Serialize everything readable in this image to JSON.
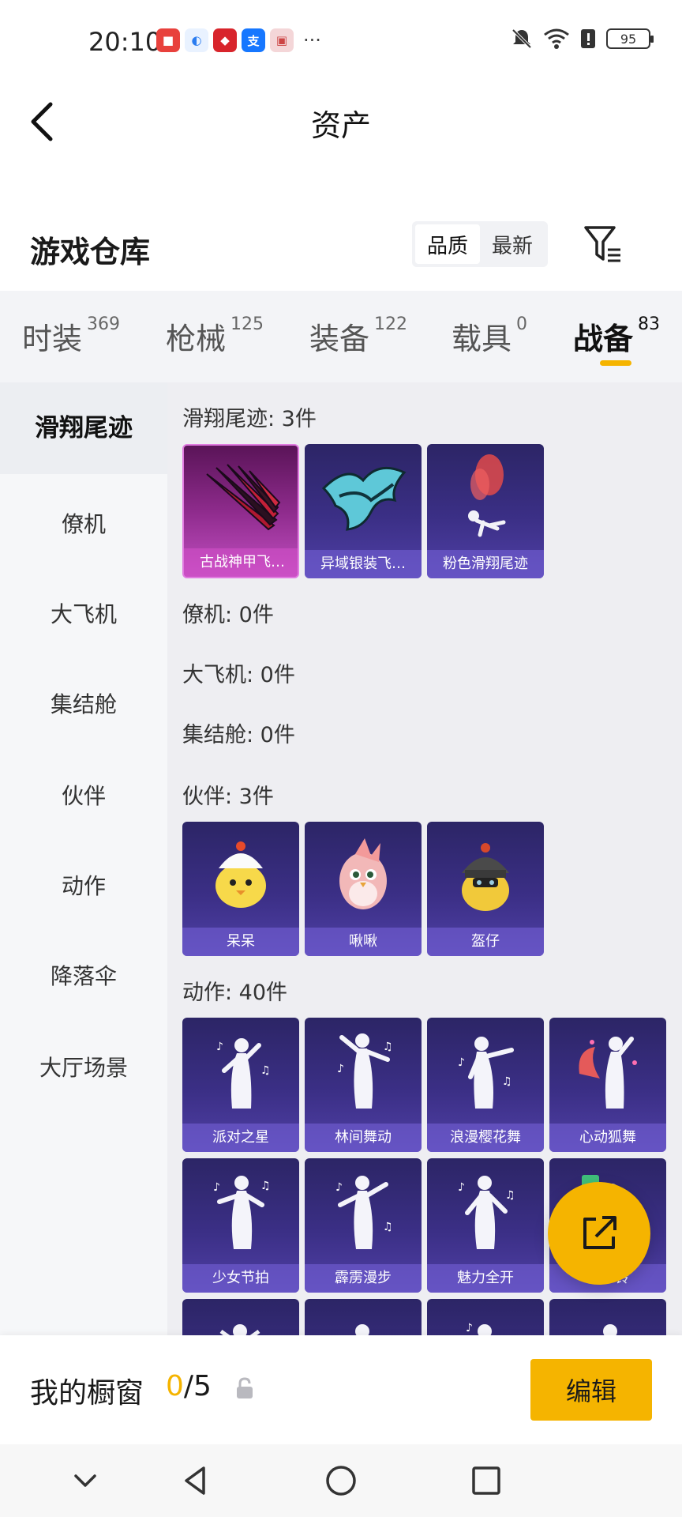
{
  "status_bar": {
    "time": "20:10",
    "more": "···",
    "battery": "95",
    "app_icons": [
      "huawei-market-icon",
      "browser-icon",
      "red-app-icon",
      "alipay-icon",
      "gift-box-icon"
    ]
  },
  "header": {
    "title": "资产"
  },
  "warehouse": {
    "title": "游戏仓库",
    "sort_options": [
      "品质",
      "最新"
    ],
    "sort_selected": "品质"
  },
  "tabs": [
    {
      "label": "时装",
      "count": "369"
    },
    {
      "label": "枪械",
      "count": "125"
    },
    {
      "label": "装备",
      "count": "122"
    },
    {
      "label": "载具",
      "count": "0"
    },
    {
      "label": "战备",
      "count": "83",
      "active": true
    }
  ],
  "sidebar": {
    "items": [
      "滑翔尾迹",
      "僚机",
      "大飞机",
      "集结舱",
      "伙伴",
      "动作",
      "降落伞",
      "大厅场景"
    ],
    "active": "滑翔尾迹"
  },
  "sections": {
    "trail": {
      "title": "滑翔尾迹: 3件",
      "items": [
        "古战神甲飞…",
        "异域银装飞…",
        "粉色滑翔尾迹"
      ]
    },
    "wingman": {
      "title": "僚机: 0件"
    },
    "plane": {
      "title": "大飞机: 0件"
    },
    "pod": {
      "title": "集结舱: 0件"
    },
    "partner": {
      "title": "伙伴: 3件",
      "items": [
        "呆呆",
        "啾啾",
        "盔仔"
      ]
    },
    "emote": {
      "title": "动作: 40件",
      "items": [
        "派对之星",
        "林间舞动",
        "浪漫樱花舞",
        "心动狐舞",
        "少女节拍",
        "霹雳漫步",
        "魅力全开",
        "清…铃"
      ]
    }
  },
  "showcase": {
    "label": "我的橱窗",
    "current": "0",
    "total": "/5",
    "edit_label": "编辑"
  },
  "colors": {
    "accent": "#f5b400",
    "card_bg": "#3b2f86",
    "card_highlight": "#c24fc2"
  }
}
